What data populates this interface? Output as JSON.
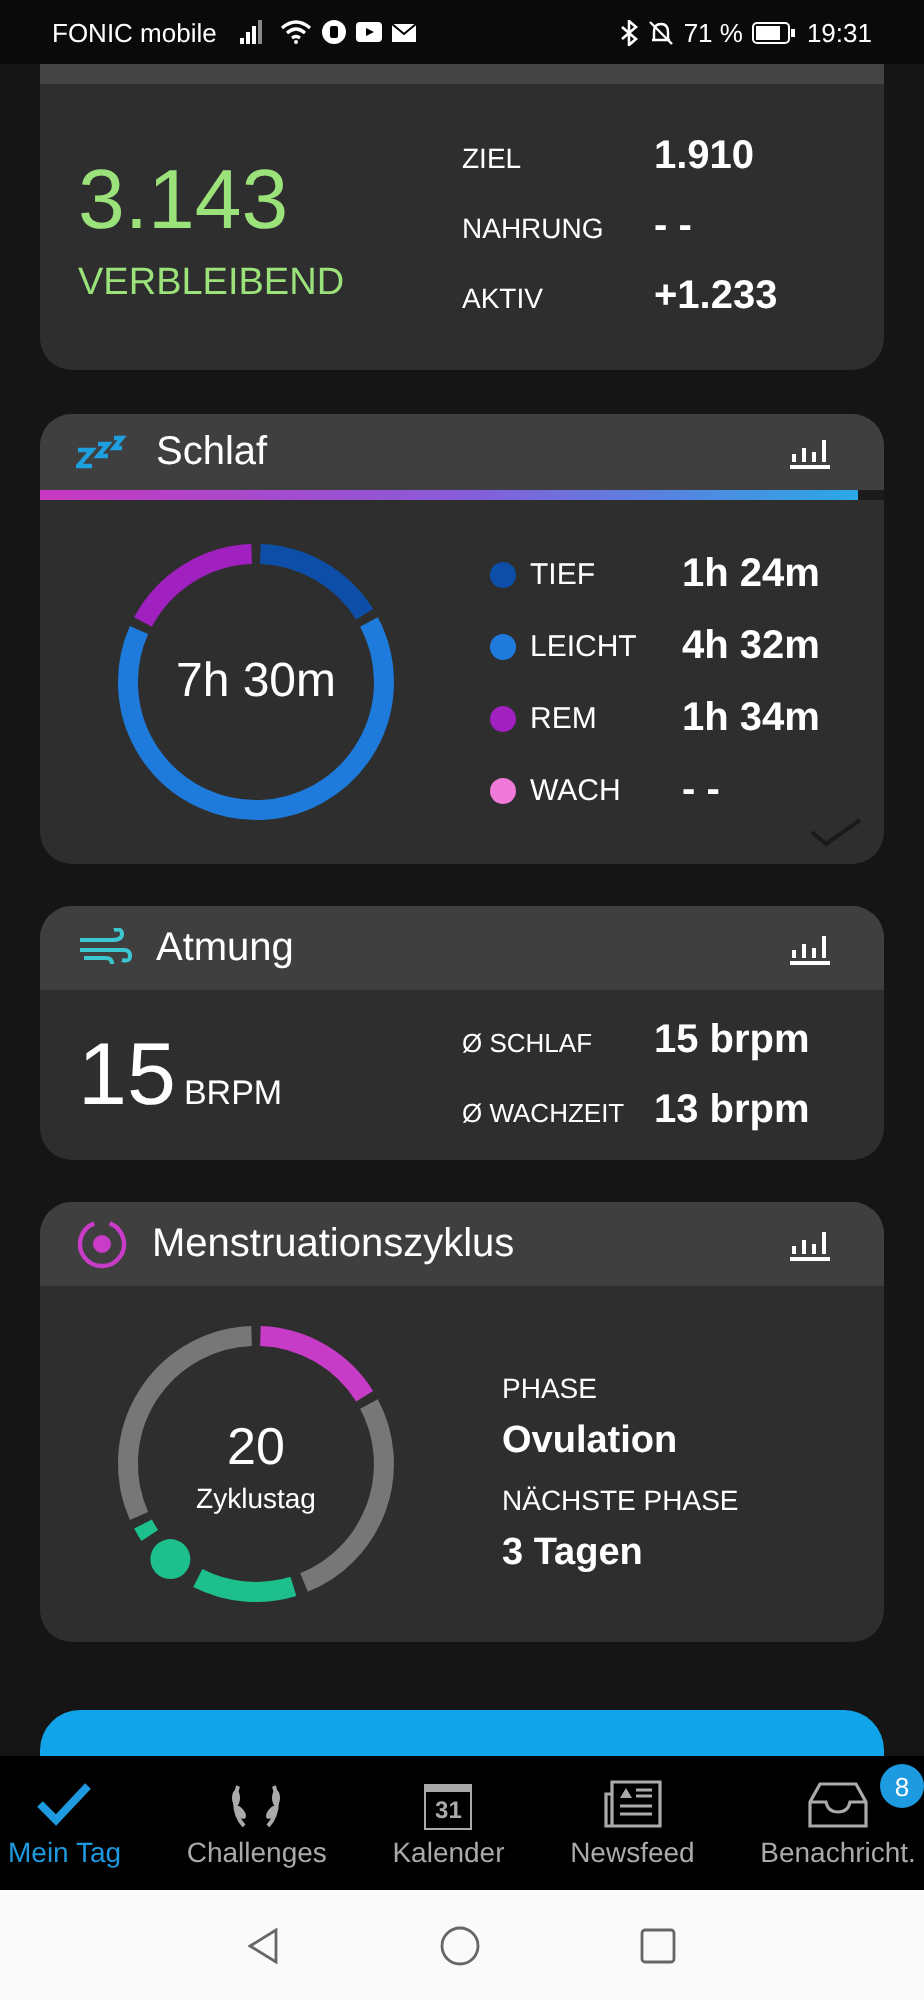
{
  "status_bar": {
    "carrier": "FONIC mobile",
    "battery": "71 %",
    "time": "19:31"
  },
  "calories": {
    "value": "3.143",
    "label": "VERBLEIBEND",
    "rows": [
      {
        "label": "ZIEL",
        "value": "1.910"
      },
      {
        "label": "NAHRUNG",
        "value": "- -"
      },
      {
        "label": "AKTIV",
        "value": "+1.233"
      }
    ]
  },
  "sleep": {
    "title": "Schlaf",
    "level": 0.97,
    "total": "7h 30m",
    "stages": [
      {
        "label": "TIEF",
        "value": "1h 24m",
        "color": "#0d4fa8"
      },
      {
        "label": "LEICHT",
        "value": "4h 32m",
        "color": "#1e7bdc"
      },
      {
        "label": "REM",
        "value": "1h 34m",
        "color": "#a020c0"
      },
      {
        "label": "WACH",
        "value": "- -",
        "color": "#f07ad8"
      }
    ]
  },
  "breathing": {
    "title": "Atmung",
    "value": "15",
    "unit": "BRPM",
    "rows": [
      {
        "label": "Ø SCHLAF",
        "value": "15 brpm"
      },
      {
        "label": "Ø WACHZEIT",
        "value": "13 brpm"
      }
    ]
  },
  "cycle": {
    "title": "Menstruationszyklus",
    "day": "20",
    "day_label": "Zyklustag",
    "rows": [
      {
        "label": "PHASE",
        "value": "Ovulation"
      },
      {
        "label": "NÄCHSTE PHASE",
        "value": "3 Tagen"
      }
    ]
  },
  "nav": [
    {
      "kind": "check",
      "label": "Mein Tag",
      "selected": true
    },
    {
      "kind": "laurel",
      "label": "Challenges",
      "selected": false
    },
    {
      "kind": "calendar",
      "label": "Kalender",
      "selected": false,
      "icon_text": "31"
    },
    {
      "kind": "news",
      "label": "Newsfeed",
      "selected": false
    },
    {
      "kind": "inbox",
      "label": "Benachricht.",
      "selected": false,
      "badge": "8"
    }
  ]
}
